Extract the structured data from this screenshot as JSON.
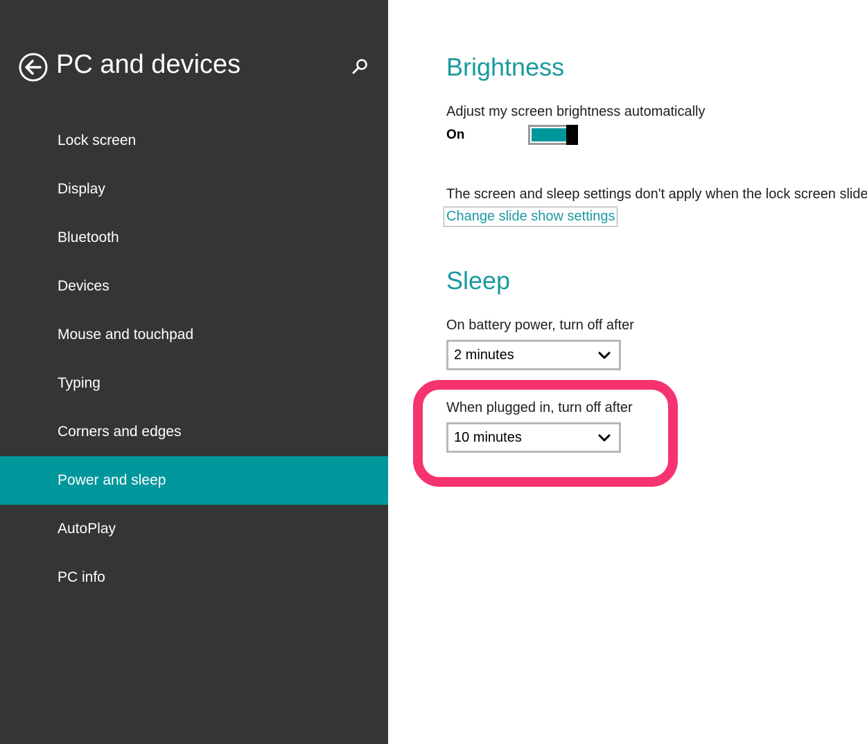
{
  "sidebar": {
    "title": "PC and devices",
    "back_icon": "back-arrow-circle-icon",
    "search_icon": "search-icon",
    "items": [
      {
        "label": "Lock screen"
      },
      {
        "label": "Display"
      },
      {
        "label": "Bluetooth"
      },
      {
        "label": "Devices"
      },
      {
        "label": "Mouse and touchpad"
      },
      {
        "label": "Typing"
      },
      {
        "label": "Corners and edges"
      },
      {
        "label": "Power and sleep",
        "selected": true
      },
      {
        "label": "AutoPlay"
      },
      {
        "label": "PC info"
      }
    ]
  },
  "brightness": {
    "heading": "Brightness",
    "auto_label": "Adjust my screen brightness automatically",
    "toggle_state": "On",
    "toggle_on": true
  },
  "slideshow": {
    "note": "The screen and sleep settings don't apply when the lock screen slide s",
    "link": "Change slide show settings"
  },
  "sleep": {
    "heading": "Sleep",
    "battery_label": "On battery power, turn off after",
    "battery_value": "2 minutes",
    "plugged_label": "When plugged in, turn off after",
    "plugged_value": "10 minutes"
  },
  "colors": {
    "sidebar_bg": "#353535",
    "accent": "#00979c",
    "heading": "#1a9aa0",
    "annotation": "#f5336f"
  }
}
